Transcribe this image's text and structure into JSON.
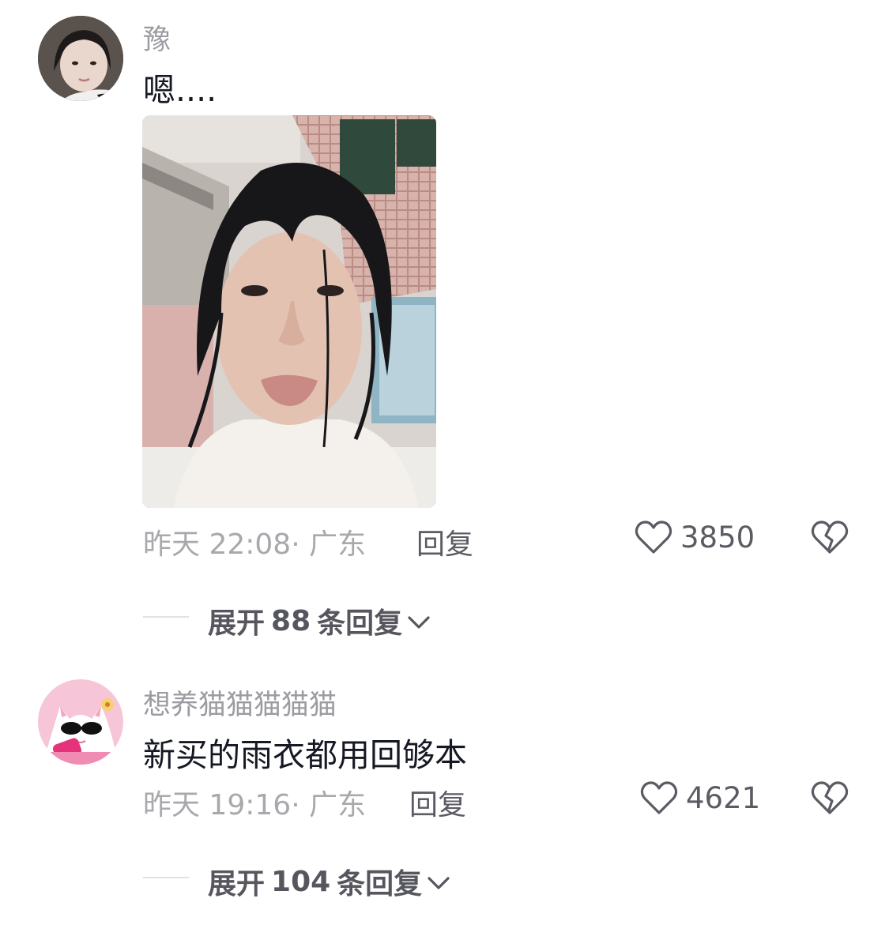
{
  "comments": [
    {
      "username": "豫",
      "text": "嗯....",
      "time": "昨天 22:08",
      "location": "· 广东",
      "reply_label": "回复",
      "likes": "3850",
      "has_image": true,
      "expand_prefix": "展开",
      "expand_count": "88",
      "expand_suffix": "条回复"
    },
    {
      "username": "想养猫猫猫猫猫",
      "text": "新买的雨衣都用回够本",
      "time": "昨天 19:16",
      "location": "· 广东",
      "reply_label": "回复",
      "likes": "4621",
      "has_image": false,
      "expand_prefix": "展开",
      "expand_count": "104",
      "expand_suffix": "条回复"
    }
  ],
  "colors": {
    "username": "#9b9ba1",
    "text": "#161823",
    "meta": "#a8a8ad",
    "action": "#5b5b63"
  },
  "icons": {
    "like": "heart-outline-icon",
    "dislike": "broken-heart-icon",
    "expand": "chevron-down-icon"
  }
}
